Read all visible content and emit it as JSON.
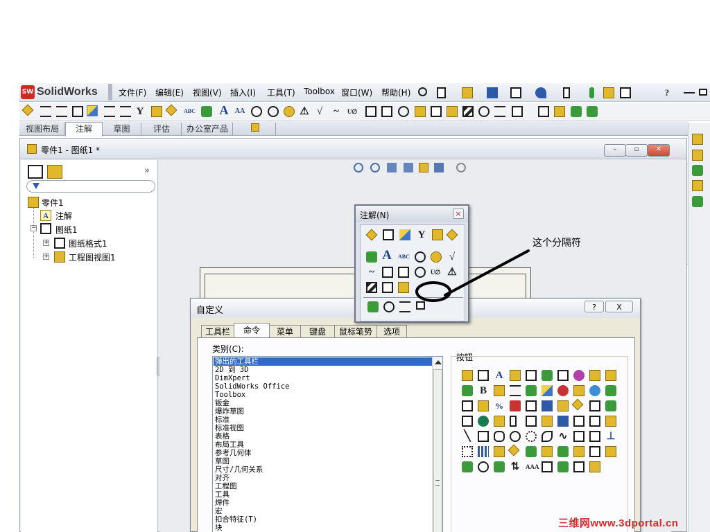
{
  "app": {
    "logo_text": "SolidWorks",
    "logo_badge": "SW"
  },
  "menu": {
    "items": [
      "文件(F)",
      "编辑(E)",
      "视图(V)",
      "插入(I)",
      "工具(T)",
      "Toolbox",
      "窗口(W)",
      "帮助(H)"
    ]
  },
  "command_tabs": [
    "视图布局",
    "注解",
    "草图",
    "评估",
    "办公室产品"
  ],
  "document": {
    "title": "零件1 - 图纸1 *"
  },
  "feature_tree": {
    "expand_symbol": "»",
    "items": [
      {
        "label": "零件1",
        "icon": "drawing-icon"
      },
      {
        "label": "注解",
        "icon": "annotation-a-icon"
      },
      {
        "label": "图纸1",
        "icon": "sheet-icon"
      },
      {
        "label": "图纸格式1",
        "icon": "sheet-format-icon"
      },
      {
        "label": "工程图视图1",
        "icon": "drawing-view-icon"
      }
    ]
  },
  "annotation_popup": {
    "title": "注解(N)",
    "close": "×"
  },
  "callout": {
    "text": "这个分隔符"
  },
  "customize_dialog": {
    "title": "自定义",
    "help": "?",
    "close": "X",
    "tabs": [
      "工具栏",
      "命令",
      "菜单",
      "键盘",
      "鼠标笔势",
      "选项"
    ],
    "active_tab": "命令",
    "category_label": "类别(C):",
    "buttons_label": "按钮",
    "categories": [
      "弹出的工具栏",
      "2D 到 3D",
      "DimXpert",
      "SolidWorks Office",
      "Toolbox",
      "钣金",
      "爆炸草图",
      "标准",
      "标准视图",
      "表格",
      "布局工具",
      "参考几何体",
      "草图",
      "尺寸/几何关系",
      "对齐",
      "工程图",
      "工具",
      "焊件",
      "宏",
      "扣合特征(T)",
      "块"
    ],
    "selected_category": "弹出的工具栏"
  },
  "watermark": {
    "text": "三维网www.3dportal.cn"
  }
}
